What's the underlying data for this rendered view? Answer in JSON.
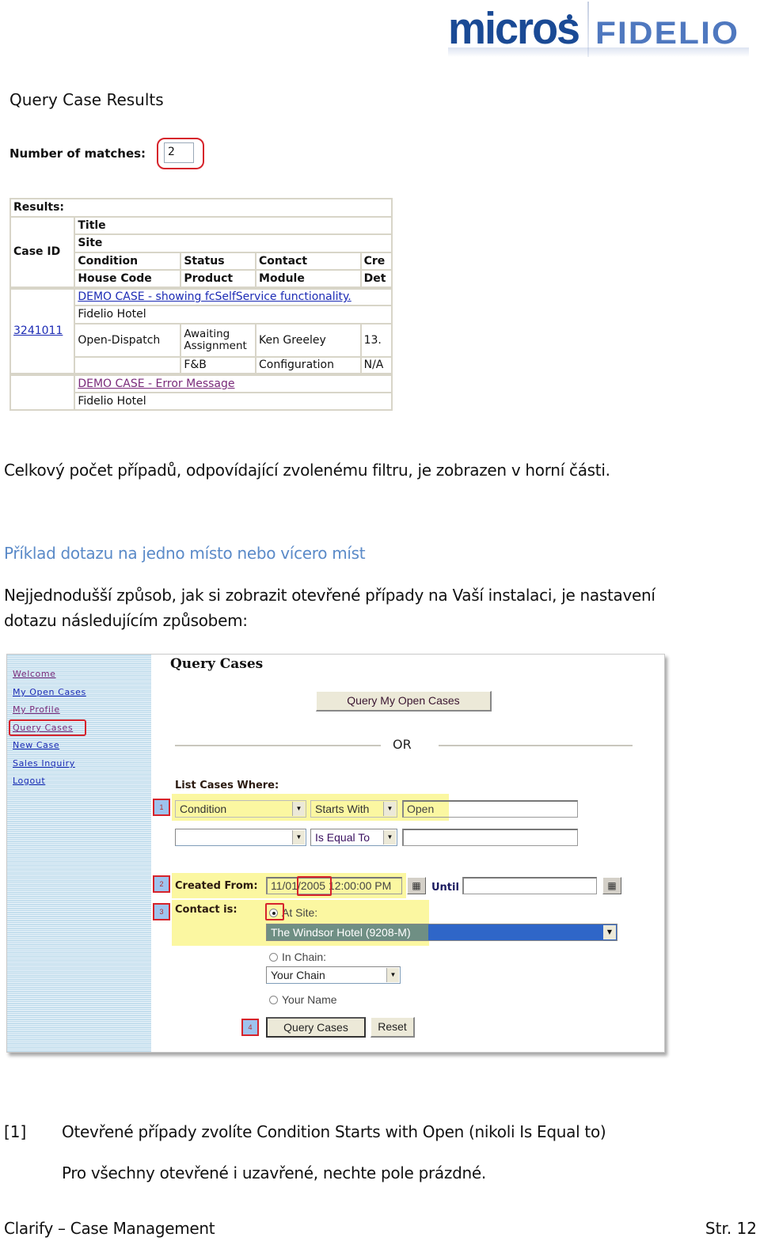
{
  "logo": {
    "brand": "micros",
    "product": "FIDELIO"
  },
  "query_results": {
    "title": "Query Case Results",
    "matches_label": "Number of matches:",
    "matches_value": "2",
    "table": {
      "caption": "Results:",
      "headers": {
        "case_id": "Case ID",
        "title": "Title",
        "site": "Site",
        "row3": [
          "Condition",
          "Status",
          "Contact",
          "Cre"
        ],
        "row4": [
          "House Code",
          "Product",
          "Module",
          "Det"
        ]
      },
      "rows": [
        {
          "case_id": "3241011",
          "title": "DEMO CASE - showing fcSelfService functionality.",
          "site": "Fidelio Hotel",
          "row3": [
            "Open-Dispatch",
            "Awaiting Assignment",
            "Ken Greeley",
            "13."
          ],
          "row4": [
            "",
            "F&B",
            "Configuration",
            "N/A"
          ]
        },
        {
          "case_id": "",
          "title": "DEMO CASE - Error Message",
          "site": "Fidelio Hotel"
        }
      ]
    }
  },
  "text": {
    "p1": "Celkový počet případů, odpovídající zvolenému filtru, je zobrazen v horní části.",
    "heading": "Příklad dotazu na jedno místo nebo vícero míst",
    "p2_line1": "Nejjednodušší způsob, jak si zobrazit otevřené případy na Vaší instalaci, je nastavení",
    "p2_line2": "dotazu následujícím způsobem:"
  },
  "query_form": {
    "sidebar": [
      {
        "label": "Welcome",
        "visited": true
      },
      {
        "label": "My Open Cases",
        "visited": false
      },
      {
        "label": "My Profile",
        "visited": true
      },
      {
        "label": "Query Cases",
        "visited": true,
        "highlighted": true
      },
      {
        "label": "New Case",
        "visited": false
      },
      {
        "label": "Sales Inquiry",
        "visited": false
      },
      {
        "label": "Logout",
        "visited": false
      }
    ],
    "title": "Query Cases",
    "query_my_open_cases": "Query My Open Cases",
    "or_label": "OR",
    "list_cases_label": "List Cases Where:",
    "criteria": [
      {
        "field": "Condition",
        "operator": "Starts With",
        "value": "Open"
      },
      {
        "field": "",
        "operator": "Is Equal To",
        "value": ""
      }
    ],
    "created_from_label": "Created From:",
    "created_from_value": "11/01/2005  12:00:00 PM",
    "until_label": "Until",
    "until_value": "",
    "contact_label": "Contact is:",
    "contact_options": {
      "at_site": "At Site:",
      "site_value": "The Windsor Hotel (9208-M)",
      "in_chain": "In Chain:",
      "chain_value": "Your Chain",
      "your_name": "Your Name"
    },
    "contact_selected": "at_site",
    "query_button": "Query Cases",
    "reset_button": "Reset",
    "steps": [
      "1",
      "2",
      "3",
      "4"
    ],
    "colors": {
      "highlight": "#fbf7a1",
      "annotation": "#d6232b",
      "selection": "#2f66c8"
    }
  },
  "notes": {
    "n1_marker": "[1]",
    "n1_text": "Otevřené případy zvolíte Condition Starts with Open (nikoli Is Equal to)",
    "n1_sub": "Pro všechny otevřené i uzavřené, nechte pole prázdné."
  },
  "footer": {
    "left": "Clarify – Case Management",
    "right": "Str. 12"
  }
}
